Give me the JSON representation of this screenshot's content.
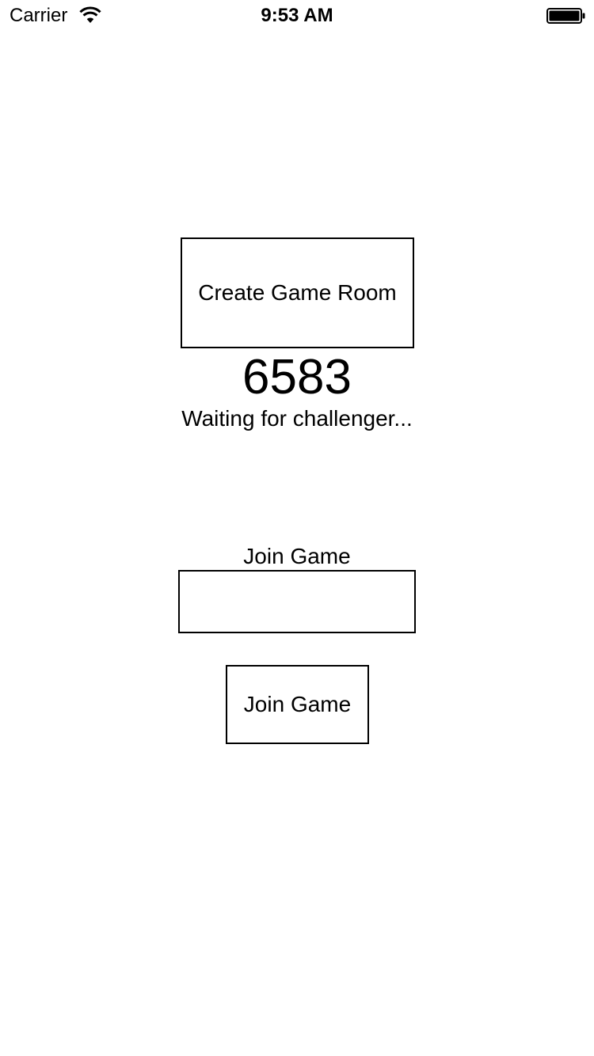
{
  "status_bar": {
    "carrier": "Carrier",
    "time": "9:53 AM",
    "wifi_icon": "wifi-icon",
    "battery_icon": "battery-icon"
  },
  "create_room": {
    "button_label": "Create Game Room",
    "room_code": "6583",
    "status_text": "Waiting for challenger..."
  },
  "join": {
    "label": "Join Game",
    "input_value": "",
    "input_placeholder": "",
    "button_label": "Join Game"
  }
}
